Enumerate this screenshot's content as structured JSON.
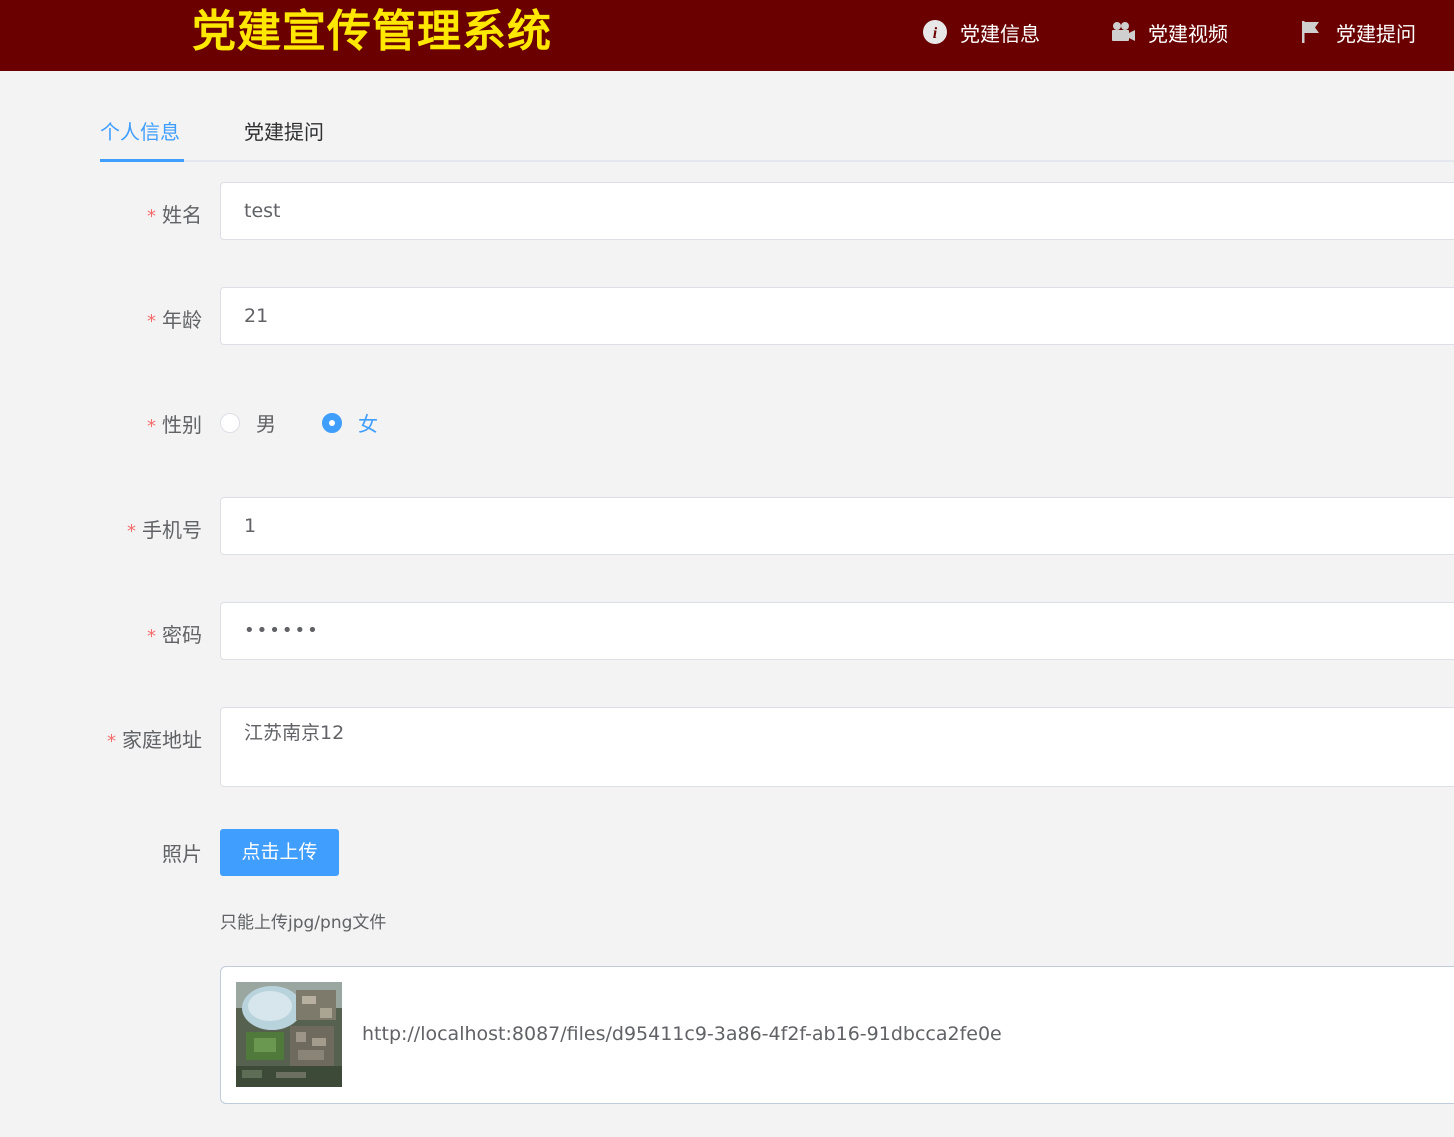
{
  "header": {
    "title": "党建宣传管理系统",
    "nav": [
      {
        "label": "党建信息",
        "icon": "info-circle-icon"
      },
      {
        "label": "党建视频",
        "icon": "video-camera-icon"
      },
      {
        "label": "党建提问",
        "icon": "flag-icon"
      }
    ],
    "colors": {
      "background": "#6b0000",
      "title": "#ffe800"
    }
  },
  "tabs": [
    {
      "label": "个人信息",
      "active": true
    },
    {
      "label": "党建提问",
      "active": false
    }
  ],
  "form": {
    "name": {
      "label": "姓名",
      "required": true,
      "value": "test"
    },
    "age": {
      "label": "年龄",
      "required": true,
      "value": "21"
    },
    "gender": {
      "label": "性别",
      "required": true,
      "options": [
        "男",
        "女"
      ],
      "selected": "女"
    },
    "phone": {
      "label": "手机号",
      "required": true,
      "value": "1"
    },
    "password": {
      "label": "密码",
      "required": true,
      "value": "••••••"
    },
    "address": {
      "label": "家庭地址",
      "required": true,
      "value": "江苏南京12"
    },
    "photo": {
      "label": "照片",
      "upload_button": "点击上传",
      "tip": "只能上传jpg/png文件",
      "file_url": "http://localhost:8087/files/d95411c9-3a86-4f2f-ab16-91dbcca2fe0e"
    },
    "required_mark": "*"
  },
  "accent_color": "#409eff"
}
